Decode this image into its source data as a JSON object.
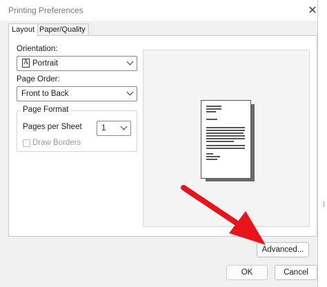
{
  "window": {
    "title": "Printing Preferences"
  },
  "tabs": [
    {
      "label": "Layout",
      "active": true
    },
    {
      "label": "Paper/Quality",
      "active": false
    }
  ],
  "orientation": {
    "label": "Orientation:",
    "value": "Portrait",
    "icon": "portrait-page-icon"
  },
  "page_order": {
    "label": "Page Order:",
    "value": "Front to Back"
  },
  "page_format": {
    "title": "Page Format",
    "pages_per_sheet_label": "Pages per Sheet",
    "pages_per_sheet_value": "1",
    "draw_borders_label": "Draw Borders",
    "draw_borders_checked": false,
    "draw_borders_enabled": false
  },
  "buttons": {
    "advanced": "Advanced...",
    "ok": "OK",
    "cancel": "Cancel"
  },
  "colors": {
    "annotation_arrow": "#e8141b",
    "disabled_text": "#9a9a9a"
  }
}
